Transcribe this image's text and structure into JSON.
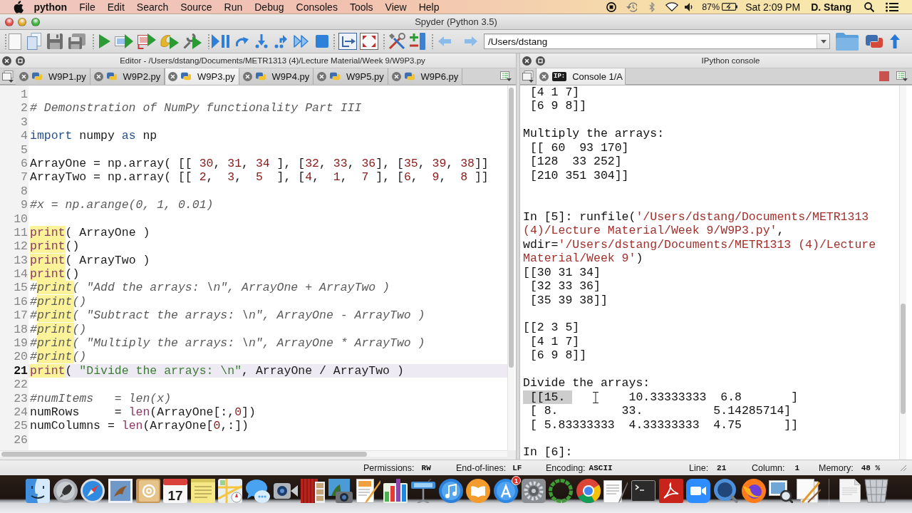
{
  "menu_bar": {
    "app": "python",
    "items": [
      "File",
      "Edit",
      "Search",
      "Source",
      "Run",
      "Debug",
      "Consoles",
      "Tools",
      "View",
      "Help"
    ],
    "battery": "87%",
    "clock": "Sat 2:09 PM",
    "user": "D. Stang"
  },
  "window": {
    "title": "Spyder (Python 3.5)"
  },
  "toolbar": {
    "path": "/Users/dstang"
  },
  "editor": {
    "title": "Editor - /Users/dstang/Documents/METR1313 (4)/Lecture Material/Week 9/W9P3.py",
    "tabs": [
      {
        "label": "W9P1.py",
        "selected": false
      },
      {
        "label": "W9P2.py",
        "selected": false
      },
      {
        "label": "W9P3.py",
        "selected": true
      },
      {
        "label": "W9P4.py",
        "selected": false
      },
      {
        "label": "W9P5.py",
        "selected": false
      },
      {
        "label": "W9P6.py",
        "selected": false
      }
    ],
    "lines": [
      {
        "number": "1",
        "current": false
      },
      {
        "number": "2",
        "current": false,
        "tokens": [
          {
            "text": "# Demonstration of NumPy functionality Part III",
            "kind": "comment"
          }
        ]
      },
      {
        "number": "3",
        "current": false
      },
      {
        "number": "4",
        "current": false,
        "tokens": [
          {
            "text": "import",
            "kind": "keyword"
          },
          {
            "text": " numpy ",
            "kind": "text"
          },
          {
            "text": "as",
            "kind": "keyword"
          },
          {
            "text": " np",
            "kind": "text"
          }
        ]
      },
      {
        "number": "5",
        "current": false
      },
      {
        "number": "6",
        "current": false,
        "tokens": [
          {
            "text": "ArrayOne = np.array( [[ ",
            "kind": "text"
          },
          {
            "text": "30",
            "kind": "number"
          },
          {
            "text": ", ",
            "kind": "text"
          },
          {
            "text": "31",
            "kind": "number"
          },
          {
            "text": ", ",
            "kind": "text"
          },
          {
            "text": "34",
            "kind": "number"
          },
          {
            "text": " ], [",
            "kind": "text"
          },
          {
            "text": "32",
            "kind": "number"
          },
          {
            "text": ", ",
            "kind": "text"
          },
          {
            "text": "33",
            "kind": "number"
          },
          {
            "text": ", ",
            "kind": "text"
          },
          {
            "text": "36",
            "kind": "number"
          },
          {
            "text": "], [",
            "kind": "text"
          },
          {
            "text": "35",
            "kind": "number"
          },
          {
            "text": ", ",
            "kind": "text"
          },
          {
            "text": "39",
            "kind": "number"
          },
          {
            "text": ", ",
            "kind": "text"
          },
          {
            "text": "38",
            "kind": "number"
          },
          {
            "text": "]]",
            "kind": "text"
          }
        ]
      },
      {
        "number": "7",
        "current": false,
        "tokens": [
          {
            "text": "ArrayTwo = np.array( [[ ",
            "kind": "text"
          },
          {
            "text": "2",
            "kind": "number"
          },
          {
            "text": ",  ",
            "kind": "text"
          },
          {
            "text": "3",
            "kind": "number"
          },
          {
            "text": ",  ",
            "kind": "text"
          },
          {
            "text": "5",
            "kind": "number"
          },
          {
            "text": "  ], [",
            "kind": "text"
          },
          {
            "text": "4",
            "kind": "number"
          },
          {
            "text": ",  ",
            "kind": "text"
          },
          {
            "text": "1",
            "kind": "number"
          },
          {
            "text": ",  ",
            "kind": "text"
          },
          {
            "text": "7",
            "kind": "number"
          },
          {
            "text": " ], [",
            "kind": "text"
          },
          {
            "text": "6",
            "kind": "number"
          },
          {
            "text": ",  ",
            "kind": "text"
          },
          {
            "text": "9",
            "kind": "number"
          },
          {
            "text": ",  ",
            "kind": "text"
          },
          {
            "text": "8",
            "kind": "number"
          },
          {
            "text": " ]]",
            "kind": "text"
          }
        ]
      },
      {
        "number": "8",
        "current": false
      },
      {
        "number": "9",
        "current": false,
        "tokens": [
          {
            "text": "#x = np.arange(0, 1, 0.01)",
            "kind": "comment"
          }
        ]
      },
      {
        "number": "10",
        "current": false
      },
      {
        "number": "11",
        "current": false,
        "tokens": [
          {
            "text": "print",
            "kind": "match"
          },
          {
            "text": "( ArrayOne )",
            "kind": "text"
          }
        ]
      },
      {
        "number": "12",
        "current": false,
        "tokens": [
          {
            "text": "print",
            "kind": "match"
          },
          {
            "text": "()",
            "kind": "text"
          }
        ]
      },
      {
        "number": "13",
        "current": false,
        "tokens": [
          {
            "text": "print",
            "kind": "match"
          },
          {
            "text": "( ArrayTwo )",
            "kind": "text"
          }
        ]
      },
      {
        "number": "14",
        "current": false,
        "tokens": [
          {
            "text": "print",
            "kind": "match"
          },
          {
            "text": "()",
            "kind": "text"
          }
        ]
      },
      {
        "number": "15",
        "current": false,
        "tokens": [
          {
            "text": "#",
            "kind": "comment"
          },
          {
            "text": "print",
            "kind": "comment-match"
          },
          {
            "text": "( \"Add the arrays: \\n\", ArrayOne + ArrayTwo )",
            "kind": "comment"
          }
        ]
      },
      {
        "number": "16",
        "current": false,
        "tokens": [
          {
            "text": "#",
            "kind": "comment"
          },
          {
            "text": "print",
            "kind": "comment-match"
          },
          {
            "text": "()",
            "kind": "comment"
          }
        ]
      },
      {
        "number": "17",
        "current": false,
        "tokens": [
          {
            "text": "#",
            "kind": "comment"
          },
          {
            "text": "print",
            "kind": "comment-match"
          },
          {
            "text": "( \"Subtract the arrays: \\n\", ArrayOne - ArrayTwo )",
            "kind": "comment"
          }
        ]
      },
      {
        "number": "18",
        "current": false,
        "tokens": [
          {
            "text": "#",
            "kind": "comment"
          },
          {
            "text": "print",
            "kind": "comment-match"
          },
          {
            "text": "()",
            "kind": "comment"
          }
        ]
      },
      {
        "number": "19",
        "current": false,
        "tokens": [
          {
            "text": "#",
            "kind": "comment"
          },
          {
            "text": "print",
            "kind": "comment-match"
          },
          {
            "text": "( \"Multiply the arrays: \\n\", ArrayOne * ArrayTwo )",
            "kind": "comment"
          }
        ]
      },
      {
        "number": "20",
        "current": false,
        "tokens": [
          {
            "text": "#",
            "kind": "comment"
          },
          {
            "text": "print",
            "kind": "comment-match"
          },
          {
            "text": "()",
            "kind": "comment"
          }
        ]
      },
      {
        "number": "21",
        "current": true,
        "tokens": [
          {
            "text": "print",
            "kind": "match"
          },
          {
            "text": "( ",
            "kind": "text"
          },
          {
            "text": "\"Divide the arrays: \\n\"",
            "kind": "string"
          },
          {
            "text": ", ArrayOne / ArrayTwo )",
            "kind": "text"
          }
        ]
      },
      {
        "number": "22",
        "current": false
      },
      {
        "number": "23",
        "current": false,
        "tokens": [
          {
            "text": "#numItems   = len(x)",
            "kind": "comment"
          }
        ]
      },
      {
        "number": "24",
        "current": false,
        "tokens": [
          {
            "text": "numRows     = ",
            "kind": "text"
          },
          {
            "text": "len",
            "kind": "builtin"
          },
          {
            "text": "(ArrayOne[:,",
            "kind": "text"
          },
          {
            "text": "0",
            "kind": "number"
          },
          {
            "text": "])",
            "kind": "text"
          }
        ]
      },
      {
        "number": "25",
        "current": false,
        "tokens": [
          {
            "text": "numColumns = ",
            "kind": "text"
          },
          {
            "text": "len",
            "kind": "builtin"
          },
          {
            "text": "(ArrayOne[",
            "kind": "text"
          },
          {
            "text": "0",
            "kind": "number"
          },
          {
            "text": ",:])",
            "kind": "text"
          }
        ]
      },
      {
        "number": "26",
        "current": false
      }
    ]
  },
  "console": {
    "title": "IPython console",
    "tabs": [
      {
        "label": "Console 1/A",
        "badge": "IP:",
        "selected": true
      }
    ],
    "lines": [
      {
        "kind": "text",
        "tokens": [
          {
            "text": " [4 1 7]",
            "kind": "text"
          }
        ]
      },
      {
        "kind": "text",
        "tokens": [
          {
            "text": " [6 9 8]]",
            "kind": "text"
          }
        ]
      },
      {
        "kind": "blank"
      },
      {
        "kind": "text",
        "tokens": [
          {
            "text": "Multiply the arrays:",
            "kind": "text"
          }
        ]
      },
      {
        "kind": "text",
        "tokens": [
          {
            "text": " [[ 60  93 170]",
            "kind": "text"
          }
        ]
      },
      {
        "kind": "text",
        "tokens": [
          {
            "text": " [128  33 252]",
            "kind": "text"
          }
        ]
      },
      {
        "kind": "text",
        "tokens": [
          {
            "text": " [210 351 304]]",
            "kind": "text"
          }
        ]
      },
      {
        "kind": "blank"
      },
      {
        "kind": "blank"
      },
      {
        "kind": "text",
        "tokens": [
          {
            "text": "In [5]: runfile(",
            "kind": "text"
          },
          {
            "text": "'/Users/dstang/Documents/METR1313",
            "kind": "string"
          }
        ]
      },
      {
        "kind": "text",
        "tokens": [
          {
            "text": "(4)/Lecture Material/Week 9/W9P3.py'",
            "kind": "string"
          },
          {
            "text": ",",
            "kind": "text"
          }
        ]
      },
      {
        "kind": "text",
        "tokens": [
          {
            "text": "wdir=",
            "kind": "text"
          },
          {
            "text": "'/Users/dstang/Documents/METR1313 (4)/Lecture",
            "kind": "string"
          }
        ]
      },
      {
        "kind": "text",
        "tokens": [
          {
            "text": "Material/Week 9'",
            "kind": "string"
          },
          {
            "text": ")",
            "kind": "text"
          }
        ]
      },
      {
        "kind": "text",
        "tokens": [
          {
            "text": "[[30 31 34]",
            "kind": "text"
          }
        ]
      },
      {
        "kind": "text",
        "tokens": [
          {
            "text": " [32 33 36]",
            "kind": "text"
          }
        ]
      },
      {
        "kind": "text",
        "tokens": [
          {
            "text": " [35 39 38]]",
            "kind": "text"
          }
        ]
      },
      {
        "kind": "blank"
      },
      {
        "kind": "text",
        "tokens": [
          {
            "text": "[[2 3 5]",
            "kind": "text"
          }
        ]
      },
      {
        "kind": "text",
        "tokens": [
          {
            "text": " [4 1 7]",
            "kind": "text"
          }
        ]
      },
      {
        "kind": "text",
        "tokens": [
          {
            "text": " [6 9 8]]",
            "kind": "text"
          }
        ]
      },
      {
        "kind": "blank"
      },
      {
        "kind": "text",
        "tokens": [
          {
            "text": "Divide the arrays:",
            "kind": "text"
          }
        ]
      },
      {
        "kind": "text",
        "tokens": [
          {
            "text": " [[15. ",
            "kind": "selection"
          },
          {
            "text": "        10.33333333  6.8       ]",
            "kind": "text"
          }
        ]
      },
      {
        "kind": "text",
        "tokens": [
          {
            "text": " [ 8.         33.          5.14285714]",
            "kind": "text"
          }
        ]
      },
      {
        "kind": "text",
        "tokens": [
          {
            "text": " [ 5.83333333  4.33333333  4.75      ]]",
            "kind": "text"
          }
        ]
      },
      {
        "kind": "blank"
      },
      {
        "kind": "text",
        "tokens": [
          {
            "text": "In [6]:",
            "kind": "text"
          }
        ]
      }
    ]
  },
  "status_bar": [
    {
      "label": "Permissions:",
      "value": "RW"
    },
    {
      "label": "End-of-lines:",
      "value": "LF"
    },
    {
      "label": "Encoding:",
      "value": "ASCII"
    },
    {
      "label": "Line:",
      "value": "21"
    },
    {
      "label": "Column:",
      "value": "1"
    },
    {
      "label": "Memory:",
      "value": "48 %"
    }
  ],
  "dock": {
    "calendar_date": "17",
    "app_badge": "1"
  }
}
